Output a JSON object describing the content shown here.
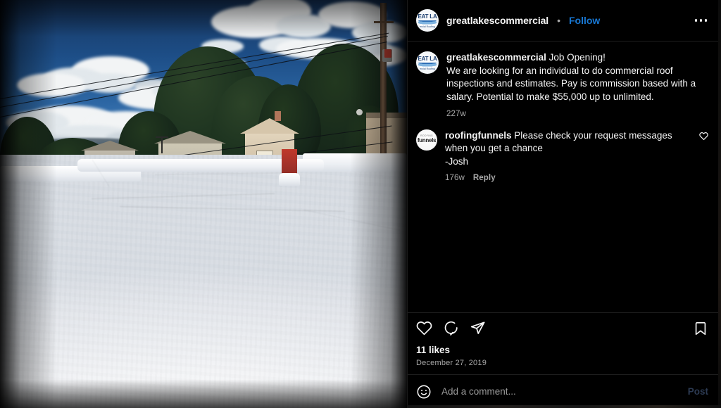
{
  "post": {
    "header": {
      "username": "greatlakescommercial",
      "separator": "•",
      "follow_label": "Follow",
      "more_icon": "ellipsis-icon",
      "avatar": {
        "logo_top": "EAT LA",
        "logo_sub": "ercial Roofing"
      }
    },
    "caption": {
      "username": "greatlakescommercial",
      "text": "Job Opening!\nWe are looking for an individual to do commercial roof inspections and estimates. Pay is commission based with a salary. Potential to make $55,000 up to unlimited.",
      "timestamp": "227w",
      "avatar": {
        "logo_top": "EAT LA",
        "logo_sub": "ercial Roofing"
      }
    },
    "comments": [
      {
        "username": "roofingfunnels",
        "text": "Please check your request messages when you get a chance\n-Josh",
        "timestamp": "176w",
        "reply_label": "Reply",
        "like_icon": "heart-icon",
        "avatar": {
          "top": "ROOFING",
          "main": "funnels"
        }
      }
    ],
    "actions": {
      "like_icon": "heart-icon",
      "comment_icon": "speech-bubble-icon",
      "share_icon": "paper-plane-icon",
      "save_icon": "bookmark-icon",
      "likes_text": "11 likes",
      "date": "December 27, 2019"
    },
    "add_comment": {
      "emoji_icon": "smiley-face-icon",
      "placeholder": "Add a comment...",
      "value": "",
      "post_label": "Post"
    }
  },
  "media": {
    "alt": "White coated flat commercial roof with blue sky, clouds, trees, houses and a red brick chimney"
  },
  "colors": {
    "background": "#000000",
    "text_primary": "#f5f5f5",
    "text_secondary": "#a8a8a8",
    "accent_blue": "#1878d4",
    "post_disabled": "#2c3a52",
    "divider": "#1e1e1e"
  }
}
